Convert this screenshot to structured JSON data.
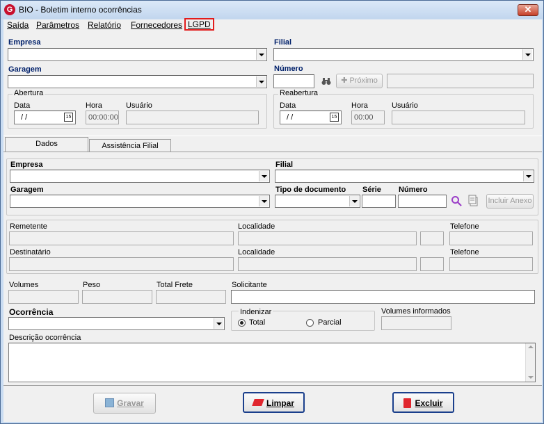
{
  "window": {
    "title": "BIO - Boletim interno ocorrências",
    "icon_letter": "G",
    "close_glyph": "✕"
  },
  "menu": {
    "items": [
      "Saída",
      "Parâmetros",
      "Relatório",
      "Fornecedores",
      "LGPD"
    ],
    "highlighted": "LGPD",
    "highlight_color": "#e21c1c"
  },
  "header": {
    "empresa_label": "Empresa",
    "filial_label": "Filial",
    "garagem_label": "Garagem",
    "numero_label": "Número",
    "proximo_label": "Próximo",
    "abertura": {
      "title": "Abertura",
      "data_label": "Data",
      "data_value": "/ /",
      "hora_label": "Hora",
      "hora_value": "00:00:00",
      "usuario_label": "Usuário"
    },
    "reabertura": {
      "title": "Reabertura",
      "data_label": "Data",
      "data_value": "/ /",
      "hora_label": "Hora",
      "hora_value": "00:00",
      "usuario_label": "Usuário"
    },
    "calendar_glyph": "15"
  },
  "tabs": [
    {
      "label": "Dados",
      "active": true
    },
    {
      "label": "Assistência Filial",
      "active": false
    }
  ],
  "dados": {
    "empresa_label": "Empresa",
    "filial_label": "Filial",
    "garagem_label": "Garagem",
    "tipo_documento_label": "Tipo de documento",
    "serie_label": "Série",
    "numero_label": "Número",
    "incluir_anexo_label": "Incluir Anexo",
    "remetente_label": "Remetente",
    "localidade_label": "Localidade",
    "telefone_label": "Telefone",
    "destinatario_label": "Destinatário",
    "localidade2_label": "Localidade",
    "telefone2_label": "Telefone",
    "volumes_label": "Volumes",
    "peso_label": "Peso",
    "total_frete_label": "Total Frete",
    "solicitante_label": "Solicitante",
    "ocorrencia_label": "Ocorrência",
    "indenizar": {
      "title": "Indenizar",
      "options": [
        "Total",
        "Parcial"
      ],
      "selected": "Total"
    },
    "volumes_informados_label": "Volumes informados",
    "descricao_label": "Descrição ocorrência"
  },
  "footer": {
    "gravar_label": "Gravar",
    "limpar_label": "Limpar",
    "excluir_label": "Excluir"
  },
  "colors": {
    "accent_navy": "#00206a",
    "search_icon": "#9b3fc8",
    "title_bar": "#c2d6ee"
  }
}
